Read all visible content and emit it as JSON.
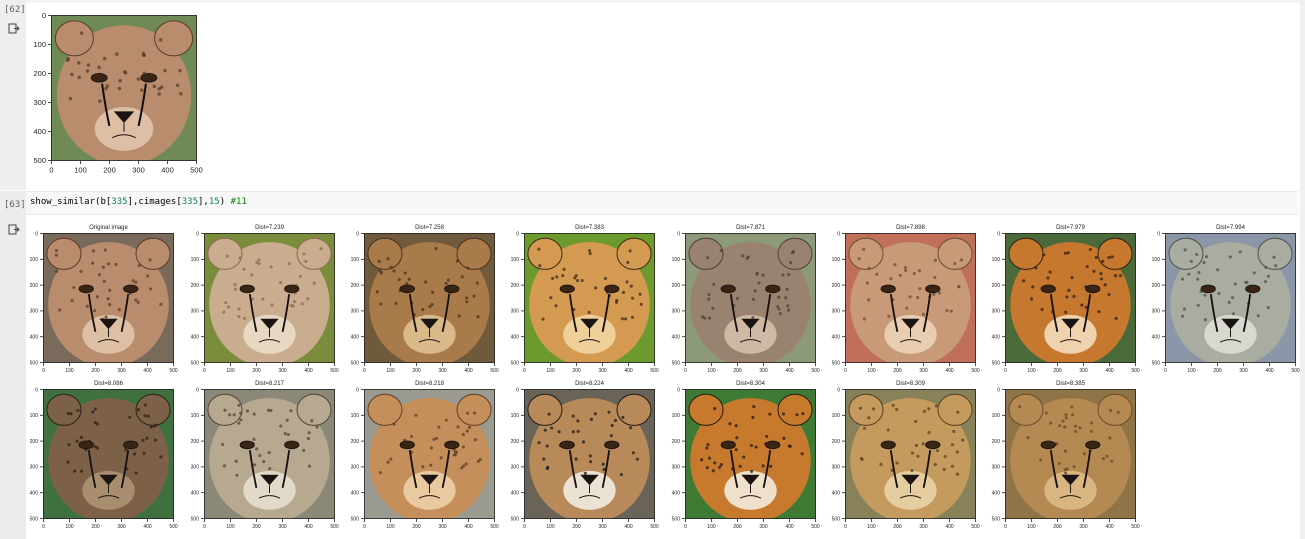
{
  "cells": [
    {
      "prompt": "[62]"
    },
    {
      "prompt": "[63]",
      "code": {
        "fn": "show_similar",
        "p1": "(b[",
        "n1": "335",
        "p2": "],cimages[",
        "n2": "335",
        "p3": "],",
        "n3": "15",
        "p4": ") ",
        "comment": "#11"
      }
    }
  ],
  "preview_axes": {
    "yticks": [
      "0",
      "100",
      "200",
      "300",
      "400",
      "500"
    ],
    "xticks": [
      "0",
      "100",
      "200",
      "300",
      "400",
      "500"
    ]
  },
  "grid_axes": {
    "yticks": [
      "0",
      "100",
      "200",
      "300",
      "400",
      "500"
    ],
    "xticks": [
      "0",
      "100",
      "200",
      "300",
      "400",
      "500"
    ]
  },
  "images": [
    {
      "title": "Original image",
      "palette": [
        "#b98c6d",
        "#5d3b2a",
        "#dcbfa4",
        "#7a6a5c"
      ]
    },
    {
      "title": "Dist=7.239",
      "palette": [
        "#c9ad8e",
        "#8a6c4f",
        "#e7d8c3",
        "#7a8d3c"
      ]
    },
    {
      "title": "Dist=7.258",
      "palette": [
        "#a97b4a",
        "#4a3220",
        "#d9b98a",
        "#6f5a3c"
      ]
    },
    {
      "title": "Dist=7.383",
      "palette": [
        "#d59a52",
        "#3d2a18",
        "#f0d09a",
        "#6d9a2c"
      ]
    },
    {
      "title": "Dist=7.871",
      "palette": [
        "#9a8270",
        "#4d4038",
        "#cdb9a4",
        "#8d9a7a"
      ]
    },
    {
      "title": "Dist=7.898",
      "palette": [
        "#c89a78",
        "#6b4b38",
        "#e8cdb3",
        "#c0705a"
      ]
    },
    {
      "title": "Dist=7.979",
      "palette": [
        "#c6782e",
        "#2e2014",
        "#efd2ae",
        "#4a6a3a"
      ]
    },
    {
      "title": "Dist=7.994",
      "palette": [
        "#a9aca0",
        "#4d524a",
        "#d7d8cf",
        "#8b96a8"
      ]
    },
    {
      "title": "Dist=8.086",
      "palette": [
        "#7d6048",
        "#2a2118",
        "#a88d6e",
        "#3e7040"
      ]
    },
    {
      "title": "Dist=8.217",
      "palette": [
        "#b7a990",
        "#4e463a",
        "#e2d9c8",
        "#8c8878"
      ]
    },
    {
      "title": "Dist=8.218",
      "palette": [
        "#c58f5c",
        "#5e3d22",
        "#e8c9a0",
        "#9a9a90"
      ]
    },
    {
      "title": "Dist=8.224",
      "palette": [
        "#b88a5a",
        "#1e1a16",
        "#ece2d4",
        "#6a6458"
      ]
    },
    {
      "title": "Dist=8.304",
      "palette": [
        "#c77a2e",
        "#241a12",
        "#efe0cc",
        "#3f7a34"
      ]
    },
    {
      "title": "Dist=8.309",
      "palette": [
        "#c59a5e",
        "#5a3e22",
        "#e6cda0",
        "#88825a"
      ]
    },
    {
      "title": "Dist=8.385",
      "palette": [
        "#b58a52",
        "#6a4a28",
        "#d9b582",
        "#8f7448"
      ]
    }
  ],
  "preview_image": {
    "palette": [
      "#b98c6d",
      "#5d3b2a",
      "#dcbfa4",
      "#6f8a55"
    ]
  }
}
